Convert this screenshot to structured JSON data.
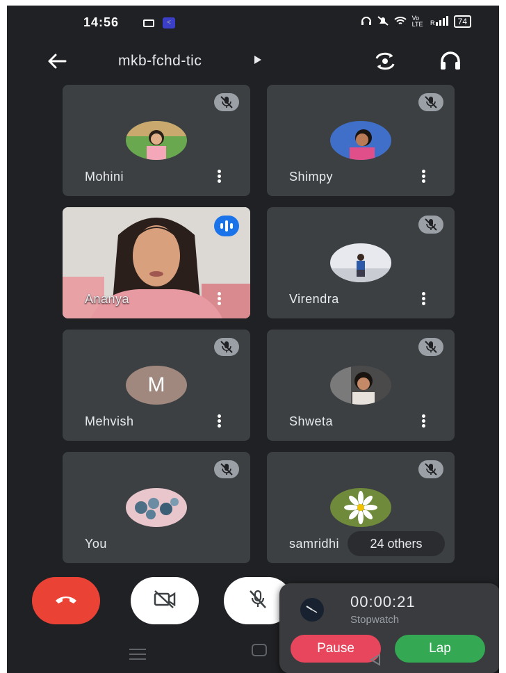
{
  "status_bar": {
    "time": "14:56",
    "battery": "74",
    "network_label": "Vo LTE"
  },
  "meeting": {
    "code": "mkb-fchd-tic"
  },
  "participants": [
    {
      "name": "Mohini",
      "muted": true
    },
    {
      "name": "Shimpy",
      "muted": true
    },
    {
      "name": "Ananya",
      "muted": false,
      "speaking": true,
      "video": true
    },
    {
      "name": "Virendra",
      "muted": true
    },
    {
      "name": "Mehvish",
      "muted": true,
      "avatar_letter": "M"
    },
    {
      "name": "Shweta",
      "muted": true
    },
    {
      "name": "You",
      "muted": true
    },
    {
      "name": "samridhi",
      "muted": true
    }
  ],
  "others_label": "24 others",
  "stopwatch": {
    "time": "00:00:21",
    "label": "Stopwatch",
    "pause_label": "Pause",
    "lap_label": "Lap"
  },
  "colors": {
    "background": "#202124",
    "tile": "#3c4043",
    "end_call": "#ea4335",
    "speaking": "#1a73e8",
    "pause": "#e8465c",
    "lap": "#34a853"
  },
  "icons": {
    "back": "arrow-left-icon",
    "switch_camera": "switch-camera-icon",
    "audio": "headphones-icon",
    "mute": "mic-off-icon",
    "end_call": "phone-hangup-icon",
    "camera_off": "video-off-icon"
  }
}
